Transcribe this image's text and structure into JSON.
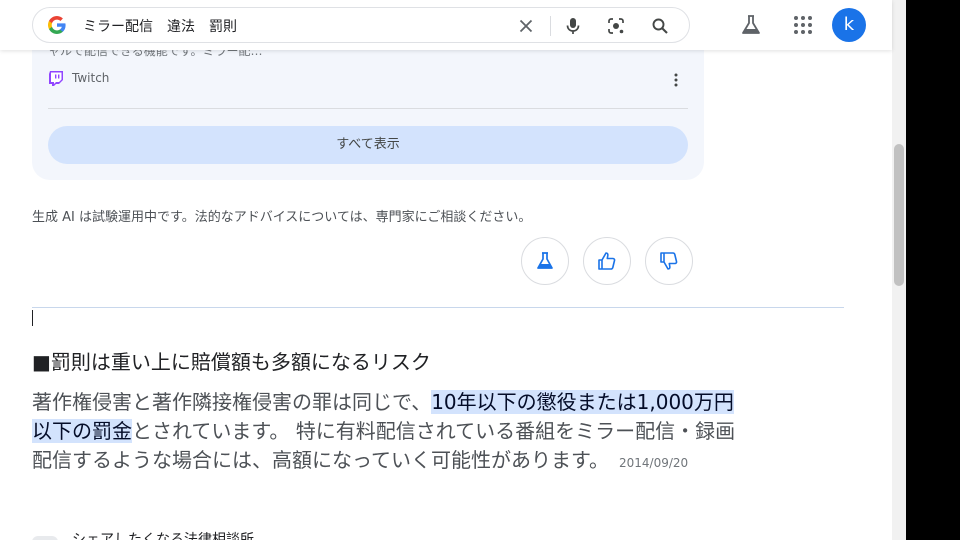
{
  "search": {
    "query": "ミラー配信　違法　罰則"
  },
  "header": {
    "avatar_letter": "k"
  },
  "card": {
    "cut_text": "ャルで配信できる機能です。ミラー配…",
    "source_name": "Twitch",
    "show_all_label": "すべて表示"
  },
  "disclaimer": "生成 AI は試験運用中です。法的なアドバイスについては、専門家にご相談ください。",
  "result": {
    "heading": "■罰則は重い上に賠償額も多額になるリスク",
    "snippet_pre": "著作権侵害と著作隣接権侵害の罪は同じで、",
    "snippet_highlight": "10年以下の懲役または1,000万円以下の罰金",
    "snippet_post": "とされています。 特に有料配信されている番組をミラー配信・録画配信するような場合には、高額になっていく可能性があります。",
    "date": "2014/09/20"
  },
  "next_source": {
    "name": "シェアしたくなる法律相談所"
  },
  "colors": {
    "accent": "#1a73e8",
    "highlight": "#d3e3fd",
    "card_bg": "#f3f6fc",
    "twitch": "#9146ff"
  }
}
